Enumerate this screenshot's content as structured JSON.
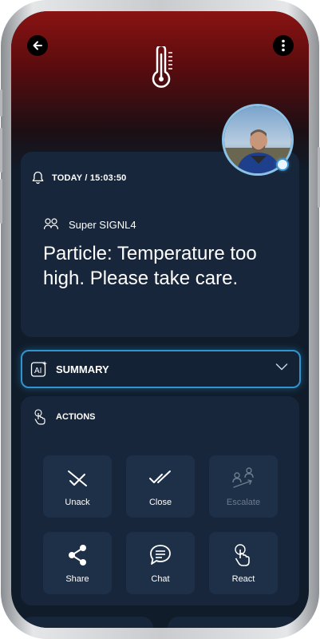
{
  "alert": {
    "timestamp": "TODAY / 15:03:50",
    "sender": "Super SIGNL4",
    "message": "Particle: Temperature too high. Please take care."
  },
  "summary": {
    "label": "SUMMARY"
  },
  "actions": {
    "title": "ACTIONS",
    "items": [
      {
        "label": "Unack",
        "icon": "unack-icon",
        "enabled": true
      },
      {
        "label": "Close",
        "icon": "double-check-icon",
        "enabled": true
      },
      {
        "label": "Escalate",
        "icon": "escalate-icon",
        "enabled": false
      },
      {
        "label": "Share",
        "icon": "share-icon",
        "enabled": true
      },
      {
        "label": "Chat",
        "icon": "chat-icon",
        "enabled": true
      },
      {
        "label": "React",
        "icon": "react-icon",
        "enabled": true
      }
    ]
  },
  "colors": {
    "header_top": "#8a1313",
    "background": "#101c2a",
    "card": "#17263a",
    "accent": "#2f95d1",
    "disabled_text": "#6d7b8c"
  }
}
